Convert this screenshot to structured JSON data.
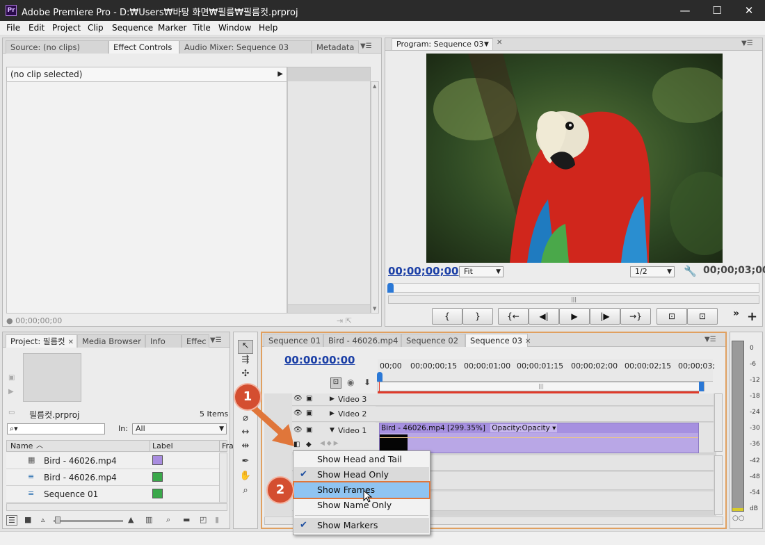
{
  "window": {
    "app_icon": "Pr",
    "title": "Adobe Premiere Pro - D:₩Users₩바탕 화면₩필름₩필름컷.prproj",
    "minimize": "—",
    "maximize": "☐",
    "close": "✕"
  },
  "menubar": [
    "File",
    "Edit",
    "Project",
    "Clip",
    "Sequence",
    "Marker",
    "Title",
    "Window",
    "Help"
  ],
  "source_panel": {
    "tabs": [
      "Source: (no clips)",
      "Effect Controls",
      "Audio Mixer: Sequence 03",
      "Metadata"
    ],
    "active_tab": "Effect Controls",
    "no_clip": "(no clip selected)",
    "timecode": "00;00;00;00"
  },
  "program_panel": {
    "tab": "Program: Sequence 03",
    "timecode_current": "00;00;00;00",
    "fit": "Fit",
    "resolution": "1/2",
    "timecode_duration": "00;00;03;00",
    "transport": [
      "{",
      "}",
      "{←",
      "◀|",
      "▶",
      "|▶",
      "→}",
      "⊡",
      "⊡"
    ],
    "more": "»",
    "add": "+"
  },
  "project_panel": {
    "tabs": [
      "Project: 필름컷",
      "Media Browser",
      "Info",
      "Effec"
    ],
    "project_name": "필름컷.prproj",
    "item_count": "5 Items",
    "search_placeholder": "",
    "in_label": "In:",
    "in_value": "All",
    "columns": [
      "Name",
      "Label",
      "Fra"
    ],
    "items": [
      {
        "name": "Bird - 46026.mp4",
        "label_color": "#a98de0",
        "icon": "film-icon"
      },
      {
        "name": "Bird - 46026.mp4",
        "label_color": "#3aa84a",
        "icon": "sequence-icon"
      },
      {
        "name": "Sequence 01",
        "label_color": "#3aa84a",
        "icon": "sequence-icon"
      }
    ]
  },
  "timeline": {
    "tabs": [
      "Sequence 01",
      "Bird - 46026.mp4",
      "Sequence 02",
      "Sequence 03"
    ],
    "active_tab": "Sequence 03",
    "timecode": "00:00:00:00",
    "ruler": [
      "00;00",
      "00;00;00;15",
      "00;00;01;00",
      "00;00;01;15",
      "00;00;02;00",
      "00;00;02;15",
      "00;00;03;"
    ],
    "tracks": [
      "Video 3",
      "Video 2",
      "Video 1"
    ],
    "clip_label": "Bird - 46026.mp4 [299.35%]",
    "clip_effect": "Opacity:Opacity"
  },
  "context_menu": {
    "items": [
      {
        "label": "Show Head and Tail",
        "checked": false
      },
      {
        "label": "Show Head Only",
        "checked": true
      },
      {
        "label": "Show Frames",
        "checked": false,
        "highlighted": true
      },
      {
        "label": "Show Name Only",
        "checked": false
      },
      {
        "label": "Show Markers",
        "checked": true
      }
    ]
  },
  "annotations": {
    "step1": "1",
    "step2": "2"
  },
  "audio_meter": {
    "ticks": [
      "0",
      "-6",
      "-12",
      "-18",
      "-24",
      "-30",
      "-36",
      "-42",
      "-48",
      "-54",
      "dB"
    ]
  },
  "colors": {
    "accent_orange": "#e0763a",
    "badge": "#d44e30",
    "clip_purple": "#b9a7e6",
    "timecode_blue": "#1b3fa6",
    "highlight": "#8fc4f2"
  }
}
